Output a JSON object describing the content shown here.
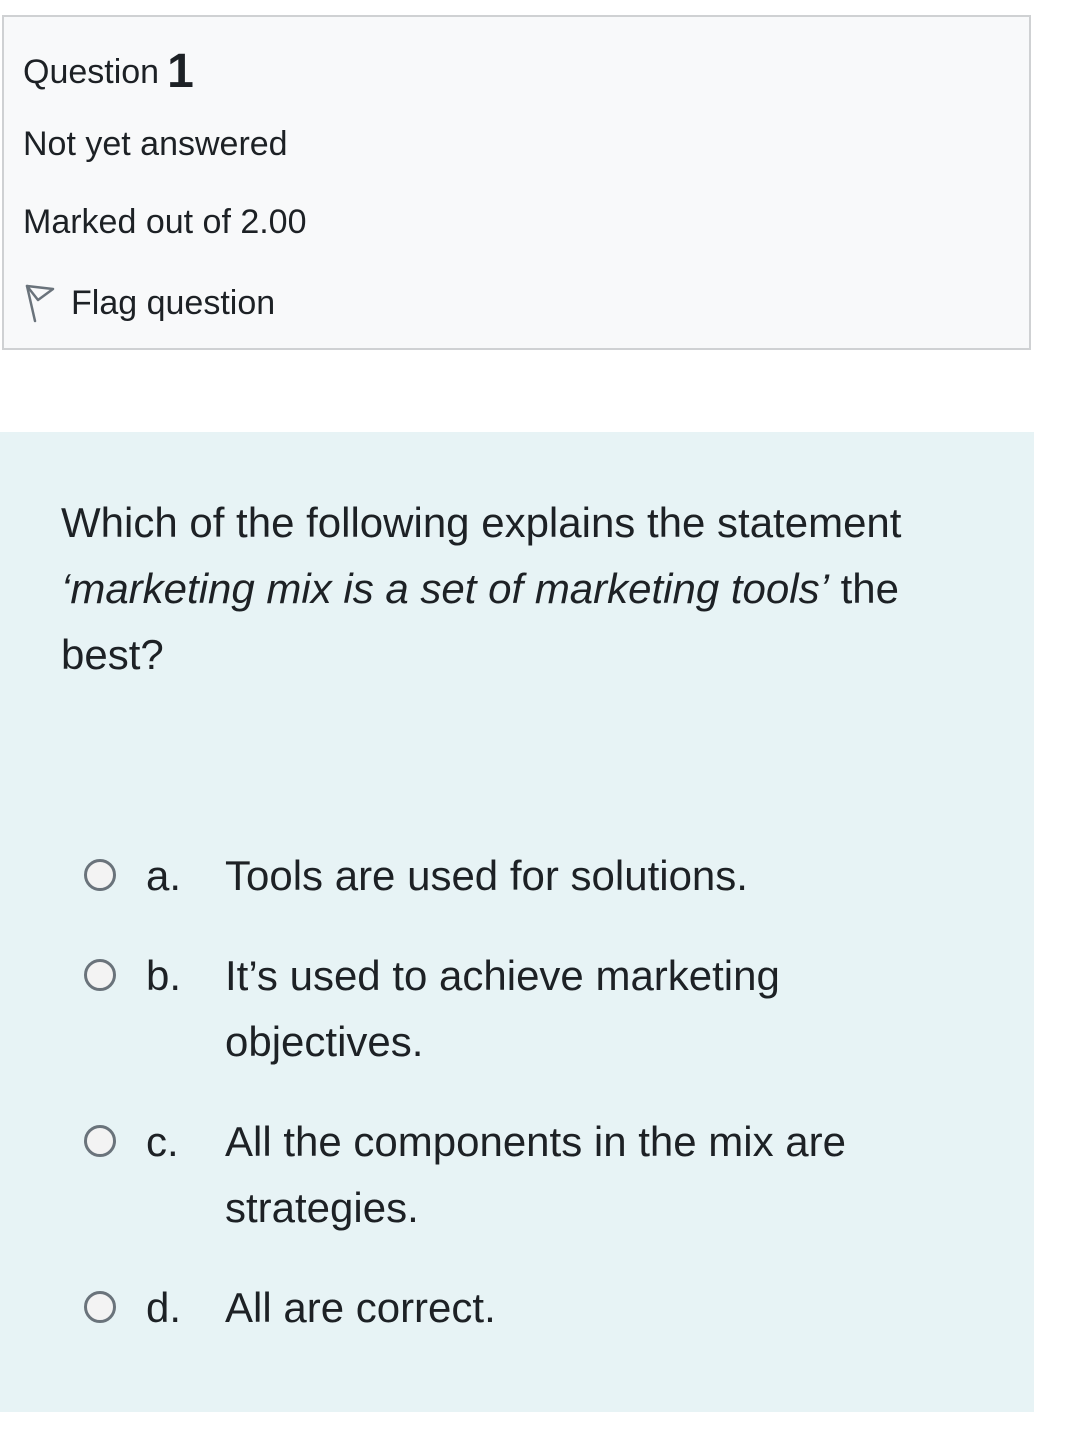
{
  "info": {
    "question_label": "Question",
    "question_number": "1",
    "state": "Not yet answered",
    "grade": "Marked out of 2.00",
    "flag_label": "Flag question",
    "flag_icon": "flag-outline-icon"
  },
  "question": {
    "text_prefix": "Which of the following explains the statement ",
    "text_emphasis": "‘marketing mix is a set of marketing tools’",
    "text_suffix": " the best?",
    "answers": [
      {
        "letter": "a.",
        "text": "Tools are used for solutions."
      },
      {
        "letter": "b.",
        "text": "It’s used to achieve marketing objectives."
      },
      {
        "letter": "c.",
        "text": "All the components in the mix are strategies."
      },
      {
        "letter": "d.",
        "text": "All are correct."
      }
    ]
  },
  "colors": {
    "info_background": "#f8f9fa",
    "question_background": "#e7f3f5",
    "text": "#1d2125"
  }
}
